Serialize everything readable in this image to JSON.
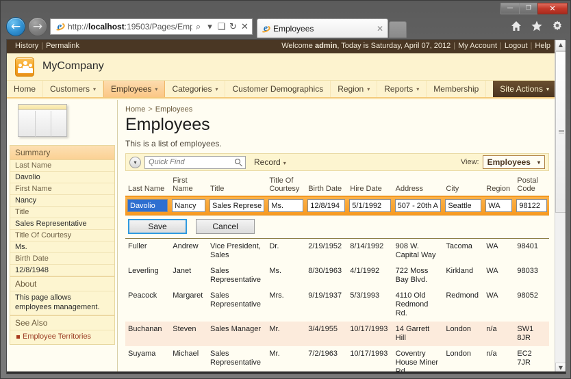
{
  "window": {
    "controls": {
      "minimize": "—",
      "maximize": "❐",
      "close": "✕"
    }
  },
  "browser": {
    "back_icon": "←",
    "forward_icon": "→",
    "url_prefix": "http://",
    "url_host": "localhost",
    "url_rest": ":19503/Pages/Emp",
    "address_icons": {
      "search": "⌕",
      "dropdown": "▾",
      "compat": "❑",
      "refresh": "↻",
      "stop": "✕"
    },
    "tab": {
      "title": "Employees",
      "close": "✕"
    },
    "command_icons": {
      "home": "home-icon",
      "favorites": "star-icon",
      "tools": "gear-icon"
    }
  },
  "utilbar": {
    "history": "History",
    "separator": "|",
    "permalink": "Permalink",
    "welcome_prefix": "Welcome ",
    "user": "admin",
    "welcome_suffix": ", Today is Saturday, April 07, 2012",
    "my_account": "My Account",
    "logout": "Logout",
    "help": "Help"
  },
  "brand": {
    "name": "MyCompany"
  },
  "mainnav": {
    "items": [
      {
        "label": "Home",
        "has_caret": false,
        "active": false
      },
      {
        "label": "Customers",
        "has_caret": true,
        "active": false
      },
      {
        "label": "Employees",
        "has_caret": true,
        "active": true
      },
      {
        "label": "Categories",
        "has_caret": true,
        "active": false
      },
      {
        "label": "Customer Demographics",
        "has_caret": false,
        "active": false
      },
      {
        "label": "Region",
        "has_caret": true,
        "active": false
      },
      {
        "label": "Reports",
        "has_caret": true,
        "active": false
      },
      {
        "label": "Membership",
        "has_caret": false,
        "active": false
      }
    ],
    "site_actions": "Site Actions",
    "caret": "▾"
  },
  "sidebar": {
    "summary_title": "Summary",
    "fields": [
      {
        "label": "Last Name",
        "value": "Davolio"
      },
      {
        "label": "First Name",
        "value": "Nancy"
      },
      {
        "label": "Title",
        "value": "Sales Representative"
      },
      {
        "label": "Title Of Courtesy",
        "value": "Ms."
      },
      {
        "label": "Birth Date",
        "value": "12/8/1948"
      }
    ],
    "about_title": "About",
    "about_text": "This page allows employees management.",
    "see_also_title": "See Also",
    "see_also_links": [
      "Employee Territories"
    ]
  },
  "main": {
    "breadcrumb": {
      "home": "Home",
      "separator": ">",
      "current": "Employees"
    },
    "page_title": "Employees",
    "page_description": "This is a list of employees.",
    "toolbar": {
      "expand_icon": "▾",
      "quick_find_placeholder": "Quick Find",
      "quick_find_value": "",
      "record_label": "Record",
      "view_label": "View:",
      "view_value": "Employees"
    },
    "columns": [
      "Last Name",
      "First Name",
      "Title",
      "Title Of Courtesy",
      "Birth Date",
      "Hire Date",
      "Address",
      "City",
      "Region",
      "Postal Code"
    ],
    "edit_row": {
      "last_name": "Davolio",
      "first_name": "Nancy",
      "title": "Sales Represe",
      "title_of_courtesy": "Ms.",
      "birth_date": "12/8/194",
      "hire_date": "5/1/1992",
      "address": "507 - 20th A",
      "city": "Seattle",
      "region": "WA",
      "postal_code": "98122",
      "save_label": "Save",
      "cancel_label": "Cancel"
    },
    "rows": [
      {
        "last_name": "Fuller",
        "first_name": "Andrew",
        "title": "Vice President, Sales",
        "courtesy": "Dr.",
        "birth_date": "2/19/1952",
        "hire_date": "8/14/1992",
        "address": "908 W. Capital Way",
        "city": "Tacoma",
        "region": "WA",
        "postal_code": "98401",
        "alt": false
      },
      {
        "last_name": "Leverling",
        "first_name": "Janet",
        "title": "Sales Representative",
        "courtesy": "Ms.",
        "birth_date": "8/30/1963",
        "hire_date": "4/1/1992",
        "address": "722 Moss Bay Blvd.",
        "city": "Kirkland",
        "region": "WA",
        "postal_code": "98033",
        "alt": false
      },
      {
        "last_name": "Peacock",
        "first_name": "Margaret",
        "title": "Sales Representative",
        "courtesy": "Mrs.",
        "birth_date": "9/19/1937",
        "hire_date": "5/3/1993",
        "address": "4110 Old Redmond Rd.",
        "city": "Redmond",
        "region": "WA",
        "postal_code": "98052",
        "alt": false
      },
      {
        "last_name": "Buchanan",
        "first_name": "Steven",
        "title": "Sales Manager",
        "courtesy": "Mr.",
        "birth_date": "3/4/1955",
        "hire_date": "10/17/1993",
        "address": "14 Garrett Hill",
        "city": "London",
        "region": "n/a",
        "postal_code": "SW1 8JR",
        "alt": true
      },
      {
        "last_name": "Suyama",
        "first_name": "Michael",
        "title": "Sales Representative",
        "courtesy": "Mr.",
        "birth_date": "7/2/1963",
        "hire_date": "10/17/1993",
        "address": "Coventry House Miner Rd.",
        "city": "London",
        "region": "n/a",
        "postal_code": "EC2 7JR",
        "alt": false
      }
    ]
  },
  "scrollbar": {
    "up": "▲",
    "down": "▼"
  },
  "colors": {
    "accent_orange": "#f79a21",
    "brand_cream": "#fdf3cf",
    "dark_brown": "#4a3724",
    "link_red": "#a8391c",
    "selection_blue": "#2e6fd0"
  }
}
